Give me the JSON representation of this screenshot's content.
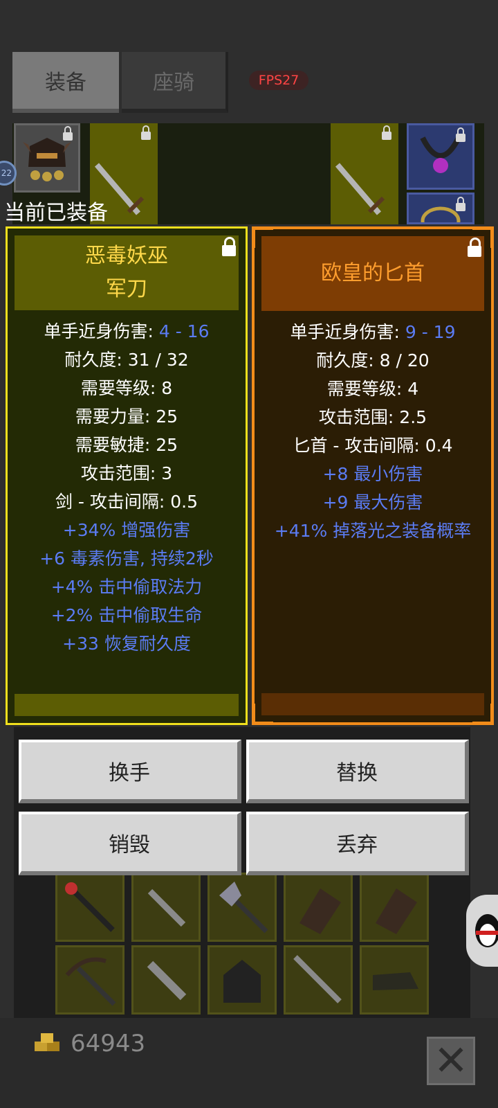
{
  "tabs": {
    "equipment": "装备",
    "mount": "座骑"
  },
  "fps": "FPS27",
  "level_badge": "22",
  "equipped_label": "当前已装备",
  "left_item": {
    "name_line1": "恶毒妖巫",
    "name_line2": "军刀",
    "stats": [
      {
        "label": "单手近身伤害: ",
        "value": "4 - 16"
      },
      {
        "label": "耐久度: 31 / 32"
      },
      {
        "label": "需要等级: 8"
      },
      {
        "label": "需要力量: 25"
      },
      {
        "label": "需要敏捷: 25"
      },
      {
        "label": "攻击范围: 3"
      },
      {
        "label": "剑 - 攻击间隔: 0.5"
      }
    ],
    "bonuses": [
      "+34% 增强伤害",
      "+6 毒素伤害, 持续2秒",
      "+4% 击中偷取法力",
      "+2% 击中偷取生命",
      "+33 恢复耐久度"
    ]
  },
  "right_item": {
    "name": "欧皇的匕首",
    "stats": [
      {
        "label": "单手近身伤害: ",
        "value": "9 - 19"
      },
      {
        "label": "耐久度: 8 / 20"
      },
      {
        "label": "需要等级: 4"
      },
      {
        "label": "攻击范围: 2.5"
      },
      {
        "label": "匕首 - 攻击间隔: 0.4"
      }
    ],
    "bonuses": [
      "+8 最小伤害",
      "+9 最大伤害",
      "+41% 掉落光之装备概率"
    ]
  },
  "buttons": {
    "swap_hand": "换手",
    "replace": "替换",
    "destroy": "销毁",
    "drop": "丢弃"
  },
  "gold": "64943",
  "colors": {
    "left_rarity": "#f1e01d",
    "right_rarity": "#f28c1a",
    "bonus_blue": "#5b7cf4"
  },
  "icons": [
    "helmet-icon",
    "sword-icon",
    "necklace-icon",
    "ring-icon",
    "scepter-icon",
    "dagger-icon",
    "axe-icon",
    "gloves-icon",
    "crossbow-icon",
    "coin-icon",
    "close-icon",
    "penguin-icon",
    "lock-icon"
  ]
}
